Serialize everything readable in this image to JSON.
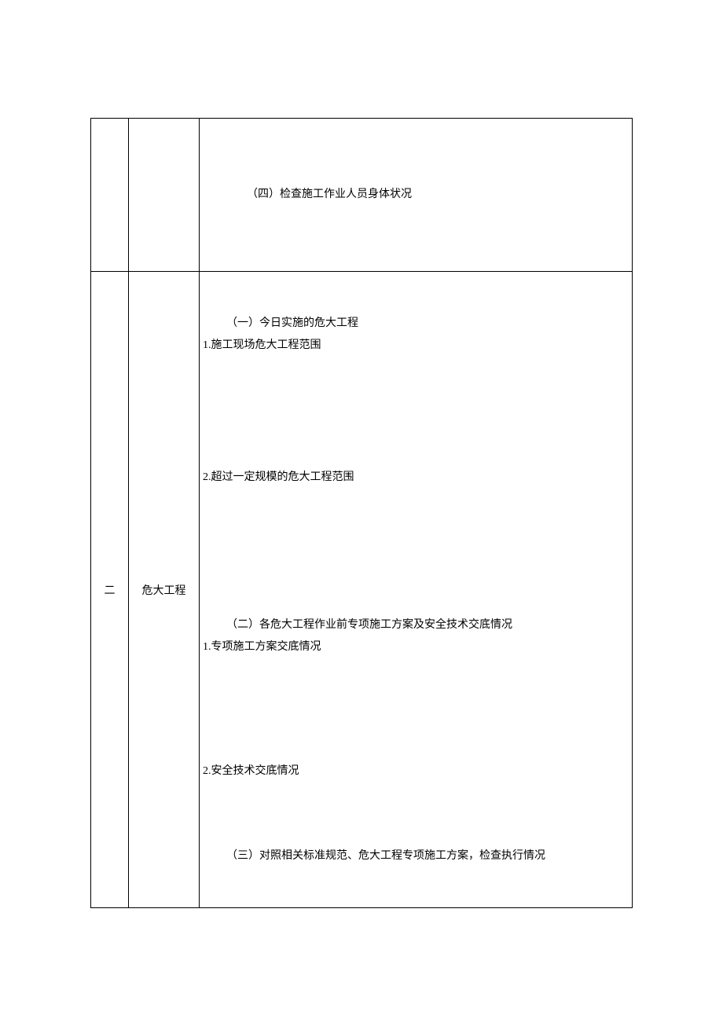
{
  "rows": [
    {
      "num": "",
      "category": "",
      "content": {
        "section4_title": "（四）检查施工作业人员身体状况"
      }
    },
    {
      "num": "二",
      "category": "危大工程",
      "content": {
        "section1_title": "（一）今日实施的危大工程",
        "section1_item1": "1.施工现场危大工程范围",
        "section1_item2": "2.超过一定规模的危大工程范围",
        "section2_title": "（二）各危大工程作业前专项施工方案及安全技术交底情况",
        "section2_item1": "1.专项施工方案交底情况",
        "section2_item2": "2.安全技术交底情况",
        "section3_title": "（三）对照相关标准规范、危大工程专项施工方案，检查执行情况"
      }
    }
  ]
}
